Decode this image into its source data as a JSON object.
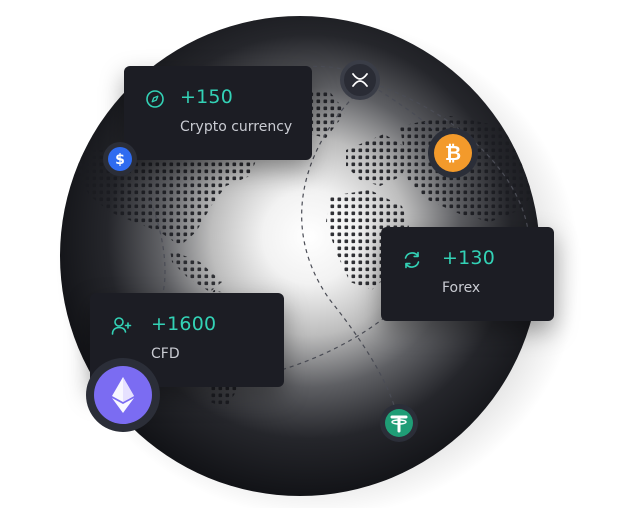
{
  "cards": {
    "crypto": {
      "value": "+150",
      "label": "Crypto currency",
      "icon": "compass-icon"
    },
    "forex": {
      "value": "+130",
      "label": "Forex",
      "icon": "refresh-icon"
    },
    "cfd": {
      "value": "+1600",
      "label": "CFD",
      "icon": "user-add-icon"
    }
  },
  "coins": {
    "xrp": {
      "icon": "xrp-icon"
    },
    "usd": {
      "icon": "dollar-icon",
      "color": "#2f6bf0"
    },
    "btc": {
      "icon": "bitcoin-icon",
      "color": "#f39a2b"
    },
    "usdt": {
      "icon": "tether-icon",
      "color": "#1f9d76"
    },
    "eth": {
      "icon": "ethereum-icon",
      "color": "#7b6cf2"
    }
  },
  "colors": {
    "accent": "#33d2b6",
    "card_bg": "#1c1d24",
    "globe_dark": "#15161a"
  }
}
